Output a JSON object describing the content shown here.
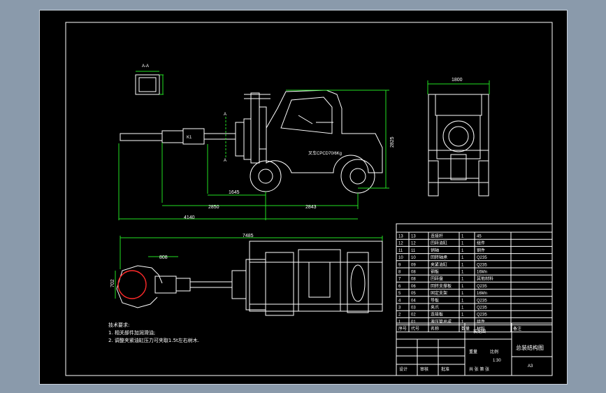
{
  "drawing": {
    "title": "总装结构图",
    "scale_label": "A3",
    "section_label": "A-A",
    "cut_label_top": "A",
    "cut_label_bottom": "A",
    "boom_tag": "K1",
    "body_label": "叉车CPCD70/6Kg",
    "tech_req": {
      "heading": "技术要求:",
      "lines": [
        "1. 相关部件加润滑油;",
        "2. 调整夹紧油缸压力可夹取1.5t左右树木."
      ]
    },
    "dimensions": {
      "front_width": "1800",
      "height": "2825",
      "d1645": "1645",
      "d2850": "2850",
      "d2843": "2843",
      "d4140": "4140",
      "d7485": "7485",
      "d808": "808",
      "d702": "702"
    }
  },
  "bom": {
    "header": [
      "序号",
      "代号",
      "名称",
      "数量",
      "材料",
      "备注"
    ],
    "rows": [
      [
        "13",
        "13",
        "连接杆",
        "1",
        "45",
        ""
      ],
      [
        "12",
        "12",
        "回转油缸",
        "1",
        "组件",
        ""
      ],
      [
        "11",
        "11",
        "销轴",
        "1",
        "钢件",
        ""
      ],
      [
        "10",
        "10",
        "回转轴承",
        "1",
        "Q235",
        ""
      ],
      [
        "9",
        "09",
        "夹紧油缸",
        "1",
        "Q235",
        ""
      ],
      [
        "8",
        "08",
        "钢板",
        "1",
        "16Mn",
        ""
      ],
      [
        "7",
        "08",
        "回转盘",
        "1",
        "其他材料",
        ""
      ],
      [
        "6",
        "06",
        "回转支撑板",
        "1",
        "Q235",
        ""
      ],
      [
        "5",
        "05",
        "固定支架",
        "1",
        "16Mn",
        ""
      ],
      [
        "4",
        "04",
        "导板",
        "1",
        "Q235",
        ""
      ],
      [
        "3",
        "03",
        "夹爪",
        "1",
        "Q235",
        ""
      ],
      [
        "2",
        "02",
        "连接板",
        "1",
        "Q235",
        ""
      ],
      [
        "1",
        "01",
        "液压管总成",
        "1",
        "组件",
        ""
      ]
    ],
    "title_cells": {
      "designed": "设计",
      "checked": "审核",
      "approved": "批准",
      "company": "装配图",
      "weight": "重量",
      "ratio": "比例",
      "ratio_val": "1:30",
      "sheet": "共 张 第 张"
    }
  },
  "colors": {
    "background": "#000000",
    "frame_bg": "#8a9aab",
    "linework": "#ffffff",
    "dimension": "#22e022",
    "highlight": "#ff2a2a"
  }
}
